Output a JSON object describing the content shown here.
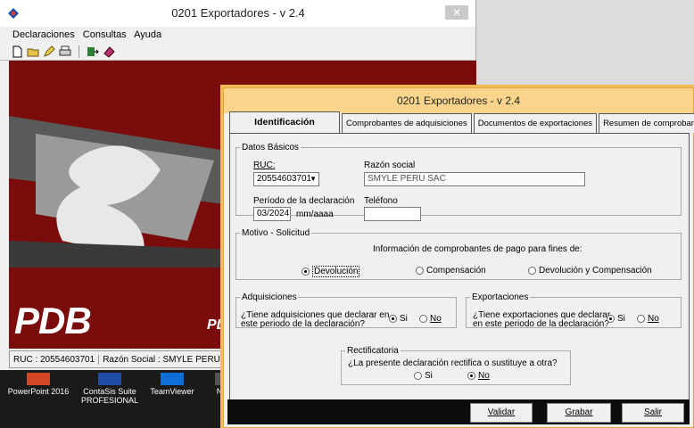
{
  "back_window": {
    "title": "0201 Exportadores - v 2.4",
    "close_glyph": "✕",
    "menu": [
      "Declaraciones",
      "Consultas",
      "Ayuda"
    ],
    "banner_brand": "PDB",
    "banner_brand_small": "PD",
    "status": {
      "ruc": "RUC : 20554603701",
      "razon": "Razón Social : SMYLE PERU SAC"
    }
  },
  "taskbar": {
    "items": [
      {
        "label": "PowerPoint 2016",
        "icon": "powerpoint-icon"
      },
      {
        "label": "ContaSis Suite PROFESIONAL",
        "label1": "ContaSis Suite",
        "label2": "PROFESIONAL",
        "icon": "contasis-icon"
      },
      {
        "label": "TeamViewer",
        "icon": "teamviewer-icon"
      },
      {
        "label": "N",
        "icon": "app-icon"
      }
    ]
  },
  "front_window": {
    "title": "0201 Exportadores - v 2.4",
    "tabs": [
      "Identificación",
      "Comprobantes de adquisiciones",
      "Documentos de exportaciones",
      "Resumen de comprobantes"
    ],
    "datos_basicos": {
      "legend": "Datos Básicos",
      "ruc_label": "RUC:",
      "ruc_value": "20554603701",
      "razon_label": "Razón social",
      "razon_value": "SMYLE PERU SAC",
      "periodo_label": "Período de la declaración",
      "periodo_value": "03/2024",
      "periodo_format": "mm/aaaa",
      "telefono_label": "Teléfono",
      "telefono_value": ""
    },
    "motivo": {
      "legend": "Motivo - Solicitud",
      "info": "Información de comprobantes de pago para fines de:",
      "options": [
        "Devolución",
        "Compensación",
        "Devolución y Compensación"
      ],
      "selected": "Devolución"
    },
    "adquisiciones": {
      "legend": "Adquisiciones",
      "question1": "¿Tiene adquisiciones que declarar en",
      "question2": "este periodo de la declaración?",
      "yes": "Si",
      "no": "No",
      "selected": "Si"
    },
    "exportaciones": {
      "legend": "Exportaciones",
      "question1": "¿Tiene exportaciones que declarar",
      "question2": "en este periodo de la declaración?",
      "yes": "Si",
      "no": "No",
      "selected": "Si"
    },
    "rectificatoria": {
      "legend": "Rectificatoria",
      "question": "¿La presente declaración rectifica o sustituye a otra?",
      "yes": "Si",
      "no": "No",
      "selected": "No"
    },
    "buttons": {
      "validar": "Validar",
      "grabar": "Grabar",
      "salir": "Salir"
    }
  },
  "colors": {
    "banner": "#7a0c0c",
    "front_title": "#fad58b",
    "front_border": "#f4bd55",
    "bottom_bar": "#0c0c0c"
  }
}
